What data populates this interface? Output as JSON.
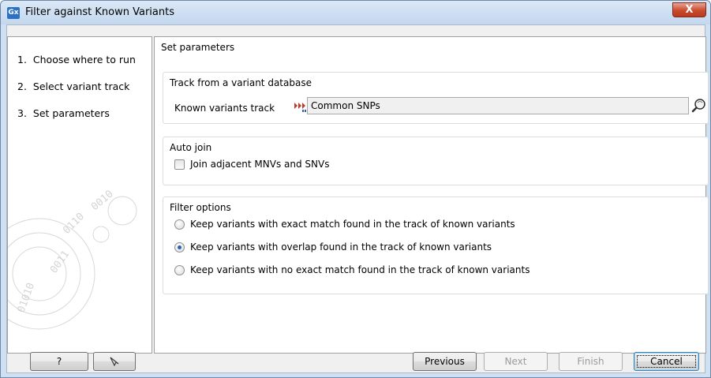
{
  "window": {
    "app_icon": "Gx",
    "title": "Filter against Known Variants",
    "close_label": "X"
  },
  "steps": [
    {
      "number": "1.",
      "label": "Choose where to run"
    },
    {
      "number": "2.",
      "label": "Select variant track"
    },
    {
      "number": "3.",
      "label": "Set parameters"
    }
  ],
  "main": {
    "heading": "Set parameters",
    "track_group": {
      "title": "Track from a variant database",
      "field_label": "Known variants track",
      "value": "Common SNPs",
      "track_icon": "variant-track-icon",
      "browse_icon": "browse-magnifier-icon"
    },
    "auto_join": {
      "title": "Auto join",
      "checkbox_label": "Join adjacent MNVs and SNVs",
      "checked": false
    },
    "filter_options": {
      "title": "Filter options",
      "options": [
        {
          "label": "Keep variants with exact match found in the track of known variants",
          "checked": false
        },
        {
          "label": "Keep variants with overlap found in the track of known variants",
          "checked": true
        },
        {
          "label": "Keep variants with no exact match found in the track of known variants",
          "checked": false
        }
      ]
    }
  },
  "footer": {
    "help_label": "?",
    "reset_icon": "reset-arrow-icon",
    "previous_label": "Previous",
    "next_label": "Next",
    "finish_label": "Finish",
    "cancel_label": "Cancel"
  },
  "colors": {
    "title_bar": "#c3d7ee",
    "close_button": "#c94a2e",
    "radio_selected": "#2a5fb3"
  }
}
